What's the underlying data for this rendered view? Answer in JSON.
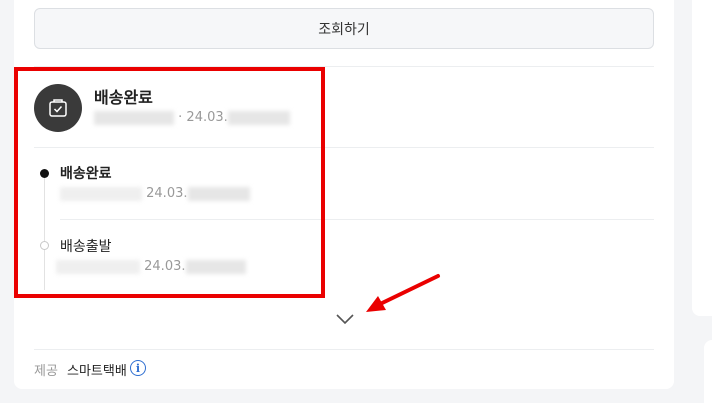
{
  "lookup_button": {
    "label": "조회하기"
  },
  "status": {
    "title": "배송완료",
    "date": "24.03."
  },
  "timeline": [
    {
      "title": "배송완료",
      "date": "24.03.",
      "active": true
    },
    {
      "title": "배송출발",
      "date": "24.03.",
      "active": false
    }
  ],
  "provider": {
    "label": "제공",
    "name": "스마트택배",
    "info_icon": "i"
  },
  "colors": {
    "highlight": "#ea0000",
    "info": "#2f6fd1",
    "icon_bg": "#3a3a3a"
  }
}
